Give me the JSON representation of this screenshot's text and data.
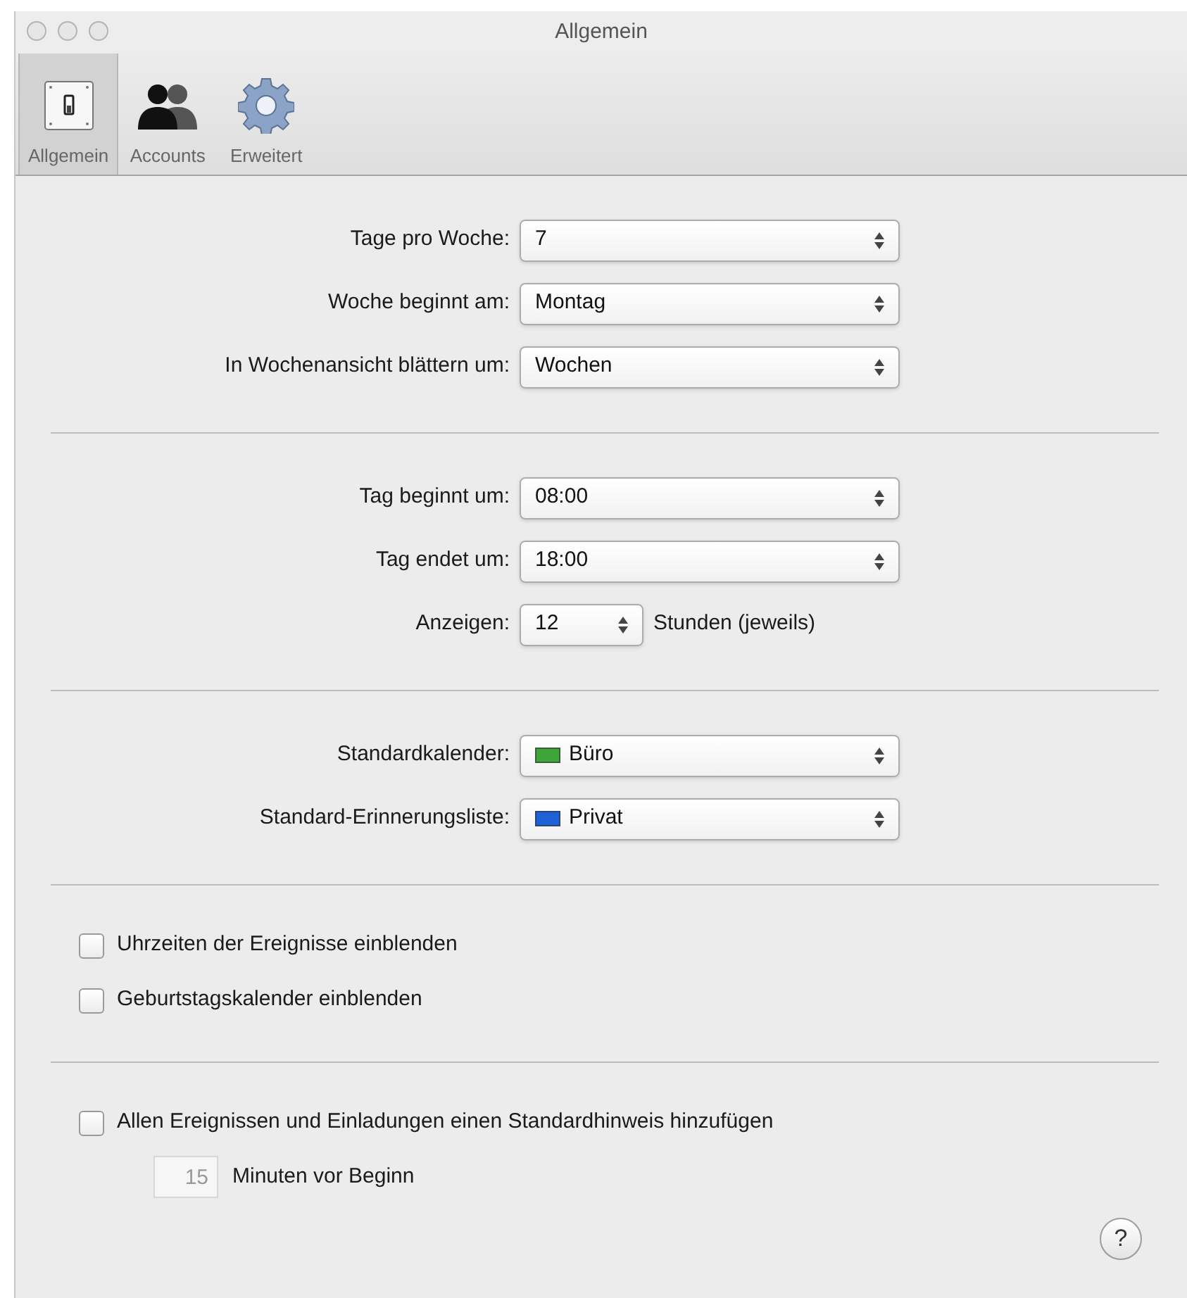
{
  "window": {
    "title": "Allgemein"
  },
  "toolbar": [
    {
      "label": "Allgemein",
      "selected": true
    },
    {
      "label": "Accounts",
      "selected": false
    },
    {
      "label": "Erweitert",
      "selected": false
    }
  ],
  "sections": [
    {
      "rows": [
        {
          "kind": "popup",
          "label": "Tage pro Woche:",
          "value": "7"
        },
        {
          "kind": "popup",
          "label": "Woche beginnt am:",
          "value": "Montag"
        },
        {
          "kind": "popup",
          "label": "In Wochenansicht blättern um:",
          "value": "Wochen"
        }
      ]
    },
    {
      "rows": [
        {
          "kind": "popup",
          "label": "Tag beginnt um:",
          "value": "08:00"
        },
        {
          "kind": "popup",
          "label": "Tag endet um:",
          "value": "18:00"
        },
        {
          "kind": "compact",
          "label": "Anzeigen:",
          "value": "12",
          "suffix": "Stunden (jeweils)"
        }
      ]
    },
    {
      "rows": [
        {
          "kind": "popup",
          "label": "Standardkalender:",
          "value": "Büro",
          "color": "#3fa53a"
        },
        {
          "kind": "popup",
          "label": "Standard-Erinnerungsliste:",
          "value": "Privat",
          "color": "#1f62d6"
        }
      ]
    },
    {
      "rows": [
        {
          "kind": "checkbox",
          "label": "Uhrzeiten der Ereignisse einblenden",
          "checked": false
        },
        {
          "kind": "checkbox",
          "label": "Geburtstagskalender einblenden",
          "checked": false
        }
      ]
    },
    {
      "rows": [
        {
          "kind": "checkbox",
          "label": "Allen Ereignissen und Einladungen einen Standardhinweis hinzufügen",
          "checked": false,
          "reminder": {
            "value": "15",
            "label": "Minuten vor Beginn",
            "disabled": true
          }
        }
      ]
    }
  ],
  "help": "?"
}
